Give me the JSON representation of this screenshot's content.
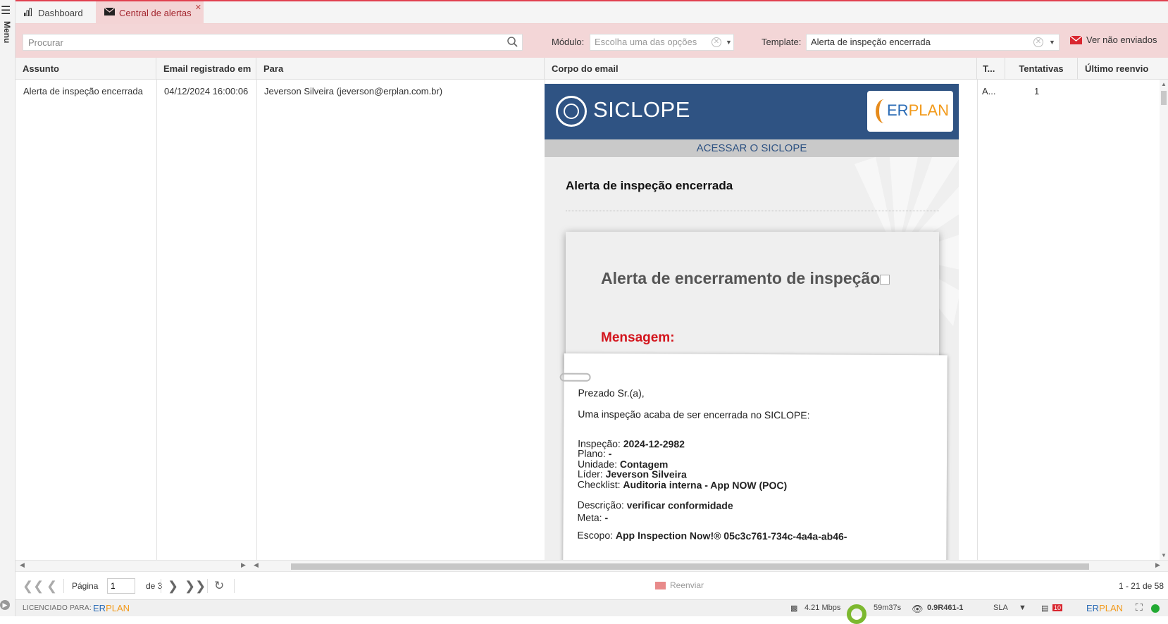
{
  "sidebar": {
    "menu_label": "Menu"
  },
  "tabs": [
    {
      "label": "Dashboard",
      "icon": "bar-chart-icon"
    },
    {
      "label": "Central de alertas",
      "icon": "envelope-icon",
      "active": true
    }
  ],
  "filters": {
    "search_placeholder": "Procurar",
    "modulo_label": "Módulo:",
    "modulo_placeholder": "Escolha uma das opções",
    "template_label": "Template:",
    "template_value": "Alerta de inspeção encerrada",
    "unsent_label": "Ver não enviados"
  },
  "columns": [
    "Assunto",
    "Email registrado em",
    "Para",
    "Corpo do email",
    "T...",
    "Tentativas",
    "Último reenvio"
  ],
  "rows": [
    {
      "assunto": "Alerta de inspeção encerrada",
      "registrado": "04/12/2024 16:00:06",
      "para": "Jeverson Silveira (jeverson@erplan.com.br)",
      "tipo": "A...",
      "tentativas": "1",
      "ultimo_reenvio": ""
    }
  ],
  "email": {
    "brand": "SICLOPE",
    "partner_logo_er": "ER",
    "partner_logo_plan": "PLAN",
    "access_link": "ACESSAR O SICLOPE",
    "title": "Alerta de inspeção encerrada",
    "card_title": "Alerta de encerramento de inspeção",
    "message_heading": "Mensagem:",
    "greeting": "Prezado Sr.(a),",
    "intro": "Uma inspeção acaba de ser encerrada no SICLOPE:",
    "fields": {
      "inspecao_label": "Inspeção:",
      "inspecao": "2024-12-2982",
      "plano_label": "Plano:",
      "plano": "-",
      "unidade_label": "Unidade:",
      "unidade": "Contagem",
      "lider_label": "Líder:",
      "lider": "Jeverson Silveira",
      "checklist_label": "Checklist:",
      "checklist": "Auditoria interna - App NOW (POC)",
      "descricao_label": "Descrição:",
      "descricao": "verificar conformidade",
      "meta_label": "Meta:",
      "meta": "-",
      "escopo_label": "Escopo:",
      "escopo": "App Inspection Now!® 05c3c761-734c-4a4a-ab46-"
    }
  },
  "pager": {
    "page_label": "Página",
    "page_value": "1",
    "of_label": "de 3",
    "resend_label": "Reenviar",
    "count": "1 - 21 de 58"
  },
  "status": {
    "licensed_label": "LICENCIADO PARA:",
    "brand_er": "ER",
    "brand_plan": "PLAN",
    "speed": "4.21 Mbps",
    "timer": "59m37s",
    "version": "0.9R461-1",
    "sla": "SLA",
    "notif_count": "10"
  },
  "colors": {
    "accent": "#d9262f",
    "tab_active_bg": "#f3d4d5",
    "email_header": "#2f5383",
    "erplan_orange": "#f29a1b"
  }
}
